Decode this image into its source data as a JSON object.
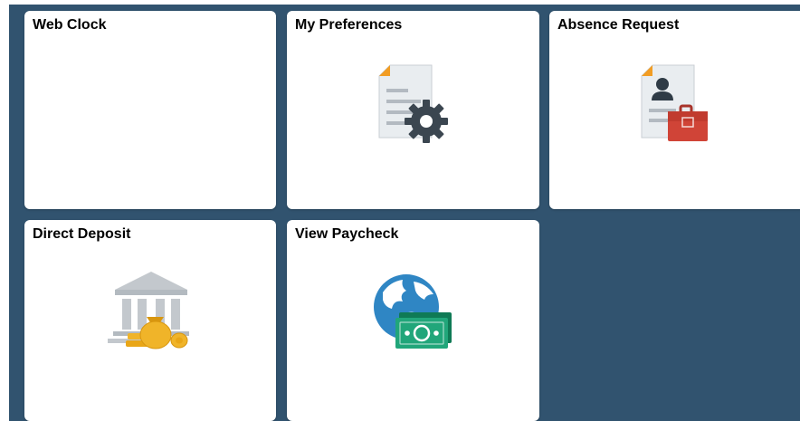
{
  "tiles": [
    {
      "title": "Web Clock",
      "icon": "none"
    },
    {
      "title": "My Preferences",
      "icon": "document-gear-icon"
    },
    {
      "title": "Absence Request",
      "icon": "document-briefcase-icon"
    },
    {
      "title": "Direct Deposit",
      "icon": "bank-money-icon"
    },
    {
      "title": "View Paycheck",
      "icon": "globe-cash-icon"
    }
  ],
  "colors": {
    "canvas_background": "#31536f",
    "tile_background": "#ffffff",
    "briefcase_red": "#d04437",
    "globe_blue": "#2f86c4",
    "cash_green": "#21a67a",
    "coin_gold": "#f0b429"
  }
}
